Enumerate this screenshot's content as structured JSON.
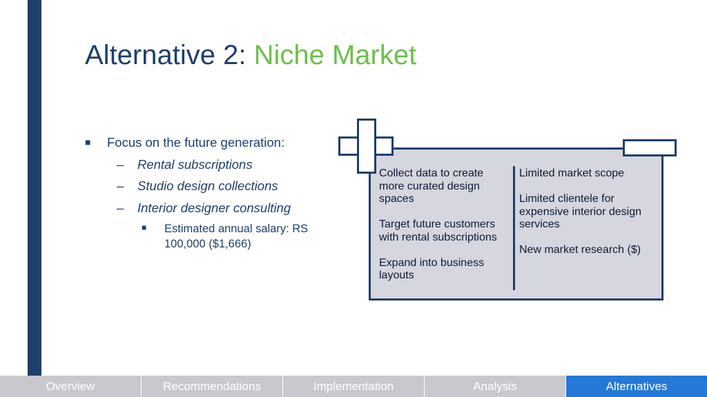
{
  "title": {
    "main": "Alternative 2:",
    "accent": "Niche Market"
  },
  "bullets": {
    "primary": "Focus on the future generation:",
    "primary_marker": "■",
    "dash": "–",
    "sub": [
      "Rental subscriptions",
      "Studio design collections",
      "Interior designer consulting"
    ],
    "tertiary_marker": "■",
    "tertiary": "Estimated annual salary: RS 100,000 ($1,666)"
  },
  "card": {
    "pros": [
      "Collect data to create more curated design spaces",
      "Target future customers with rental subscriptions",
      "Expand into business layouts"
    ],
    "cons": [
      "Limited market scope",
      "Limited clientele for expensive interior design services",
      "New market research ($)"
    ],
    "plus_icon": "plus-sign",
    "minus_icon": "minus-sign"
  },
  "nav": {
    "items": [
      "Overview",
      "Recommendations",
      "Implementation",
      "Analysis",
      "Alternatives"
    ],
    "active": "Alternatives"
  },
  "colors": {
    "primary": "#1f3f6b",
    "accent": "#6cc04a",
    "nav_inactive": "#c8c9ce",
    "nav_active": "#2478d6",
    "card_bg": "#d5d6de"
  }
}
